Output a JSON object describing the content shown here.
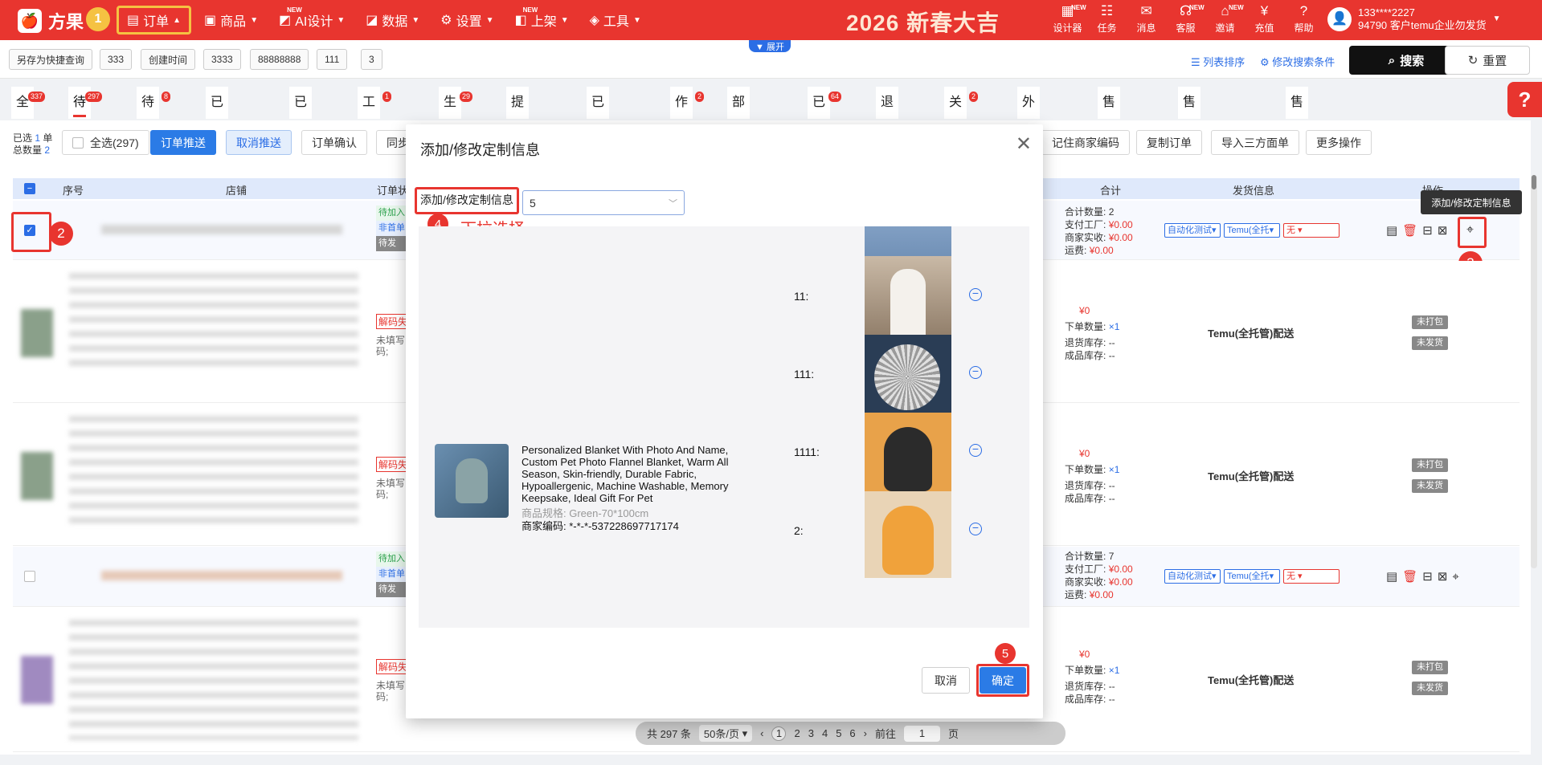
{
  "topbar": {
    "logo": "方果",
    "nav": [
      {
        "label": "订单",
        "icon": "order-icon",
        "active": true
      },
      {
        "label": "商品",
        "icon": "goods-icon"
      },
      {
        "label": "AI设计",
        "icon": "ai-icon",
        "new": "NEW"
      },
      {
        "label": "数据",
        "icon": "chart-icon"
      },
      {
        "label": "设置",
        "icon": "gear-icon"
      },
      {
        "label": "上架",
        "icon": "shelf-icon",
        "new": "NEW"
      },
      {
        "label": "工具",
        "icon": "toolbox-icon"
      }
    ],
    "banner": "2026 新春大吉",
    "tools": [
      {
        "label": "设计器",
        "new": "NEW"
      },
      {
        "label": "任务"
      },
      {
        "label": "消息"
      },
      {
        "label": "客服",
        "new": "NEW"
      },
      {
        "label": "邀请",
        "new": "NEW"
      },
      {
        "label": "充值"
      },
      {
        "label": "帮助"
      }
    ],
    "user": {
      "phone": "133****2227",
      "account": "94790 客户temu企业勿发货"
    }
  },
  "searchbar": {
    "chips": [
      "另存为快捷查询",
      "333",
      "创建时间",
      "3333",
      "88888888",
      "111",
      "3"
    ],
    "expand": "▼ 展开",
    "sort_link": "列表排序",
    "modify_link": "修改搜索条件",
    "search": "搜索",
    "reset": "重置"
  },
  "tabs": [
    {
      "label": "全部",
      "count": "337"
    },
    {
      "label": "待整理",
      "count": "297"
    },
    {
      "label": "待推送",
      "count": "8"
    },
    {
      "label": "已反审",
      "count": ""
    },
    {
      "label": "已锁单",
      "count": ""
    },
    {
      "label": "工厂待审",
      "count": "1"
    },
    {
      "label": "生产中",
      "count": "29"
    },
    {
      "label": "提前发货",
      "count": ""
    },
    {
      "label": "已打包",
      "count": ""
    },
    {
      "label": "作废",
      "count": "2"
    },
    {
      "label": "部分发货",
      "count": ""
    },
    {
      "label": "已发货",
      "count": "64"
    },
    {
      "label": "退款中",
      "count": ""
    },
    {
      "label": "关闭",
      "count": "2"
    },
    {
      "label": "外部发货",
      "count": ""
    },
    {
      "label": "售后草稿",
      "count": ""
    },
    {
      "label": "售后已提交",
      "count": ""
    },
    {
      "label": "售后完成",
      "count": ""
    }
  ],
  "toolbar": {
    "selected_prefix": "已选",
    "selected": "1",
    "selected_unit": "单",
    "total_prefix": "总数量",
    "total": "2",
    "select_all": "全选(297)",
    "push": "订单推送",
    "cancel_push": "取消推送",
    "confirm": "订单确认",
    "sync": "同步",
    "right_buttons": [
      "记住商家编码",
      "复制订单",
      "导入三方面单",
      "更多操作"
    ]
  },
  "table": {
    "headers": [
      "序号",
      "店铺",
      "订单状",
      "合计",
      "发货信息",
      "操作"
    ],
    "row1": {
      "status_tags": [
        "待加入",
        "非首单",
        "待发"
      ],
      "summary": [
        {
          "label": "合计数量:",
          "value": "2"
        },
        {
          "label": "支付工厂:",
          "value": "¥0.00"
        },
        {
          "label": "商家实收:",
          "value": "¥0.00"
        },
        {
          "label": "运费:",
          "value": "¥0.00"
        }
      ],
      "selects": [
        "自动化测试",
        "Temu(全托",
        "无"
      ]
    },
    "subrows": [
      {
        "price": "¥0",
        "order_qty_label": "下单数量:",
        "order_qty": "×1",
        "return_label": "退货库存:",
        "return": "--",
        "finished_label": "成品库存:",
        "finished": "--",
        "ship": "Temu(全托管)配送",
        "tags": [
          "未打包",
          "未发货"
        ],
        "decode": "解码失",
        "unfilled": "未填写",
        "unfilled2": "码;"
      },
      {
        "price": "¥0",
        "order_qty_label": "下单数量:",
        "order_qty": "×1",
        "return_label": "退货库存:",
        "return": "--",
        "finished_label": "成品库存:",
        "finished": "--",
        "ship": "Temu(全托管)配送",
        "tags": [
          "未打包",
          "未发货"
        ],
        "decode": "解码失",
        "unfilled": "未填写",
        "unfilled2": "码;"
      },
      {
        "price": "¥0",
        "order_qty_label": "下单数量:",
        "order_qty": "×1",
        "return_label": "退货库存:",
        "return": "--",
        "finished_label": "成品库存:",
        "finished": "--",
        "ship": "Temu(全托管)配送",
        "tags": [
          "未打包",
          "未发货"
        ],
        "decode": "解码失",
        "unfilled": "未填写",
        "unfilled2": "码;"
      }
    ],
    "row2": {
      "status_tags": [
        "待加入",
        "非首单",
        "待发"
      ],
      "summary": [
        {
          "label": "合计数量:",
          "value": "7"
        },
        {
          "label": "支付工厂:",
          "value": "¥0.00"
        },
        {
          "label": "商家实收:",
          "value": "¥0.00"
        },
        {
          "label": "运费:",
          "value": "¥0.00"
        }
      ],
      "selects": [
        "自动化测试",
        "Temu(全托",
        "无"
      ]
    }
  },
  "tooltip": "添加/修改定制信息",
  "modal": {
    "title": "添加/修改定制信息",
    "field_label": "添加/修改定制信息",
    "field_value": "5",
    "hint": "下拉选择",
    "product": {
      "title": "Personalized Blanket With Photo And Name, Custom Pet Photo Flannel Blanket, Warm All Season, Skin-friendly, Durable Fabric, Hypoallergenic, Machine Washable, Memory Keepsake, Ideal Gift For Pet",
      "spec": "商品规格: Green-70*100cm",
      "code": "商家编码: *-*-*-537228697717174"
    },
    "items": [
      {
        "label": "11:"
      },
      {
        "label": "111:"
      },
      {
        "label": "1111:"
      },
      {
        "label": "2:"
      }
    ],
    "cancel": "取消",
    "ok": "确定"
  },
  "pager": {
    "total": "共 297 条",
    "page_size": "50条/页",
    "pages": [
      "1",
      "2",
      "3",
      "4",
      "5",
      "6"
    ],
    "goto_label": "前往",
    "goto_value": "1",
    "page_unit": "页"
  },
  "markers": [
    "1",
    "2",
    "3",
    "4",
    "5"
  ],
  "colors": {
    "brand": "#e8352f",
    "accent": "#2b7be6",
    "highlight": "#f5c242"
  }
}
